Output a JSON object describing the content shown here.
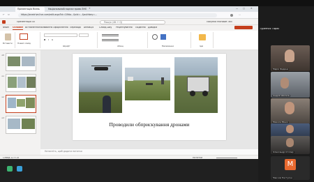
{
  "meeting": {
    "top_title": "",
    "presenter": "Туренчія Тарас",
    "participants": [
      {
        "name": "Марія Фединa"
      },
      {
        "name": "Андрій Шапель"
      },
      {
        "name": "Микола Мінко"
      },
      {
        "name": "Олександр Звяг"
      },
      {
        "name": "Олександр Сгопер"
      },
      {
        "name": "Максим Паступка",
        "initial": "M"
      }
    ]
  },
  "browser": {
    "tabs": [
      "Презентація Ясень",
      "Національний портал призи ЗНО...",
      "+"
    ],
    "url": "https://onedrive.live.com/edit.aspx?id=10fda...&cid=...&authkey=...",
    "window_controls": [
      "—",
      "□",
      "✕"
    ]
  },
  "ppt": {
    "app_label": "Презентація 45",
    "search_placeholder": "Пошук (Alt + Q)",
    "account": "Покупка Microsoft 365",
    "ribbon_tabs": [
      "Файл",
      "Основне",
      "Вставлення",
      "Малювання",
      "Оформлення",
      "Переходи",
      "Анімація",
      "Слайд-шоу",
      "Рецензування",
      "Подання",
      "Довідка"
    ],
    "active_tab": "Основне",
    "ribbon_groups": [
      "Вставити",
      "Новий слайд",
      "Шрифт",
      "Абзац",
      "Малювання",
      "Ідеї"
    ],
    "notes_placeholder": "Натисніть, щоб додати нотатки",
    "status_left": "Слайд 12 з 15",
    "status_right": "Нотатки"
  },
  "thumbnails": [
    {
      "num": "10"
    },
    {
      "num": "11"
    },
    {
      "num": "12",
      "selected": true
    },
    {
      "num": "13"
    }
  ],
  "slide": {
    "caption": "Проводили обприскування дронами"
  },
  "colors": {
    "accent": "#c43e1c",
    "sky": "#9fb6c9",
    "field": "#6d7f3a"
  }
}
